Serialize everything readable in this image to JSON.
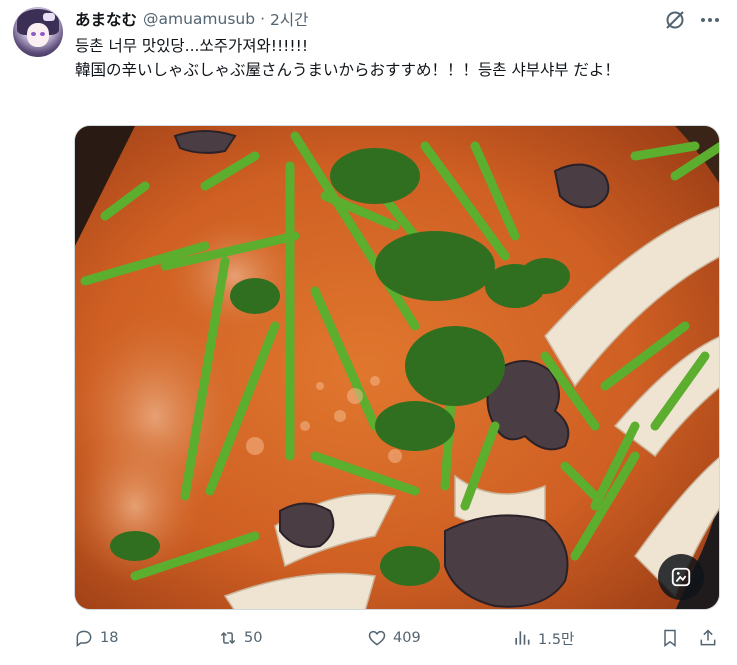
{
  "author": {
    "display_name": "あまなむ",
    "handle": "@amuamusub",
    "separator": "·",
    "time": "2시간"
  },
  "tweet": {
    "line1": "등촌 너무 맛있당...쏘주가져와!!!!!!",
    "line2": "韓国の辛いしゃぶしゃぶ屋さんうまいからおすすめ！！！등촌 샤부샤부 だよ！"
  },
  "actions": {
    "replies": "18",
    "reposts": "50",
    "likes": "409",
    "views": "1.5만"
  },
  "icons": {
    "grok": "grok-icon",
    "more": "more-icon",
    "reply": "reply-icon",
    "repost": "repost-icon",
    "like": "heart-icon",
    "views": "views-icon",
    "bookmark": "bookmark-icon",
    "share": "share-icon",
    "edit_image": "edit-image-icon"
  },
  "colors": {
    "text_primary": "#0f1419",
    "text_secondary": "#536471",
    "broth": "#d26a2c"
  }
}
